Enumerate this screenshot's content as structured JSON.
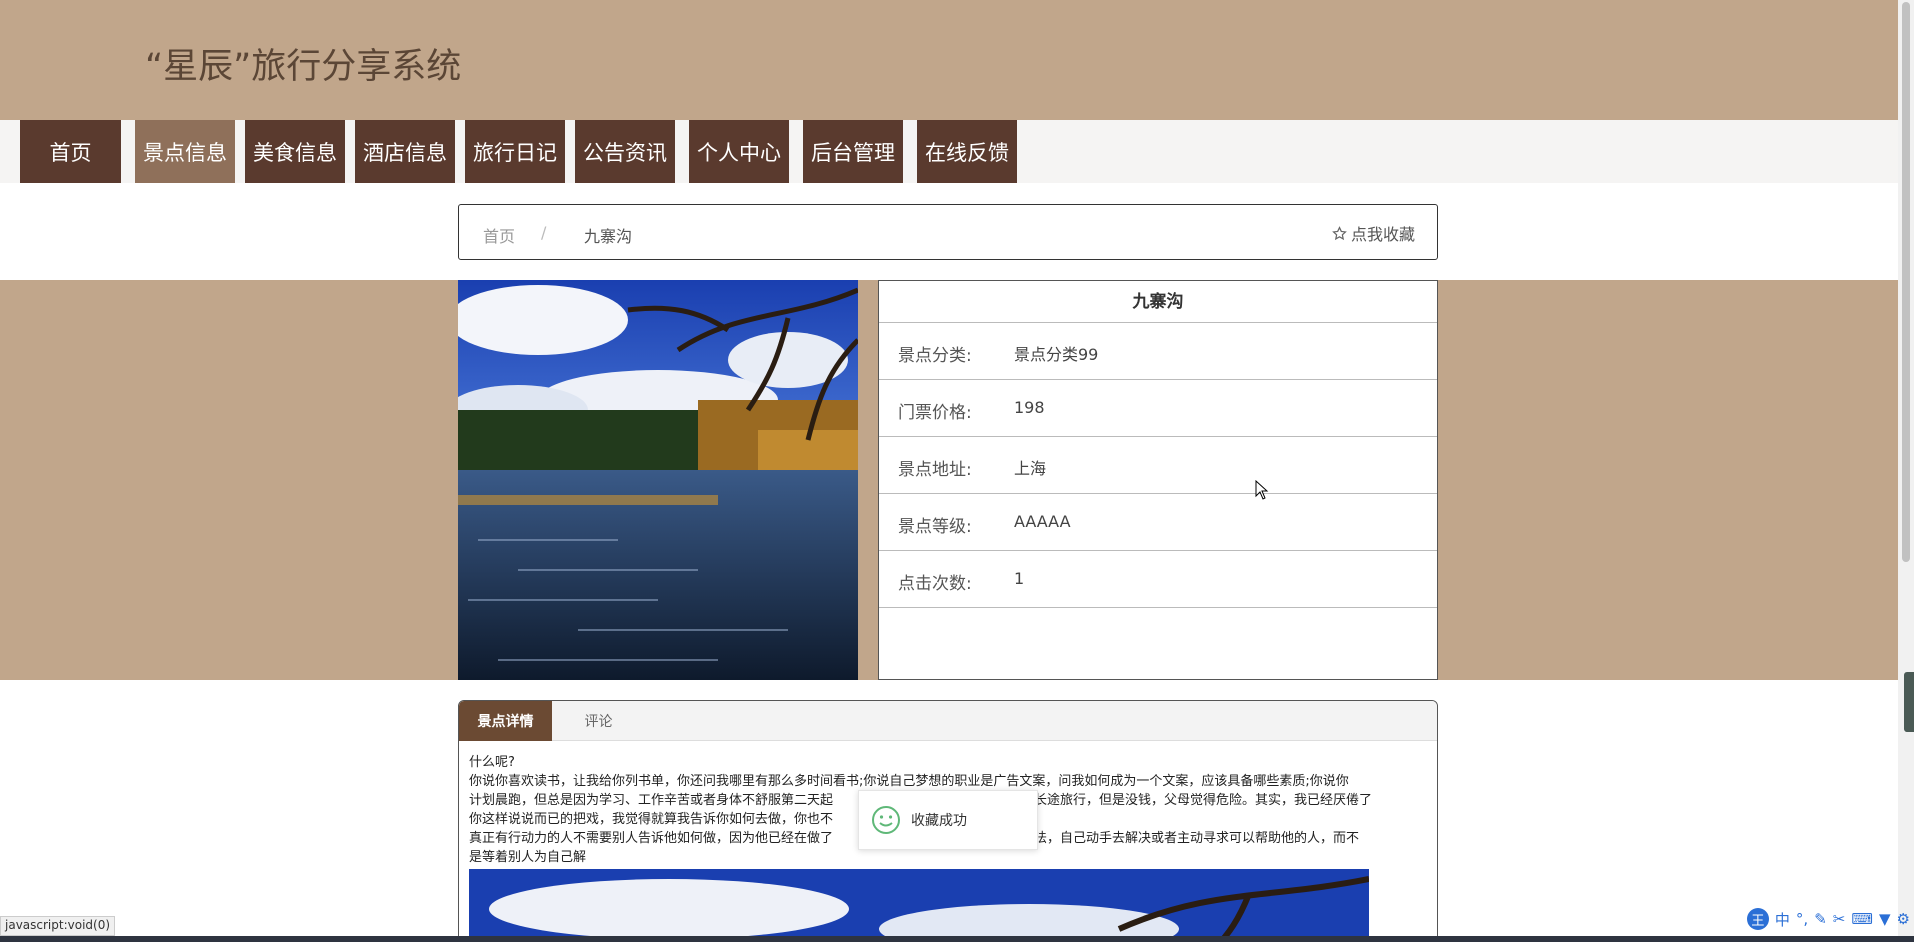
{
  "header": {
    "title": "“星辰”旅行分享系统"
  },
  "nav": {
    "items": [
      {
        "label": "首页"
      },
      {
        "label": "景点信息"
      },
      {
        "label": "美食信息"
      },
      {
        "label": "酒店信息"
      },
      {
        "label": "旅行日记"
      },
      {
        "label": "公告资讯"
      },
      {
        "label": "个人中心"
      },
      {
        "label": "后台管理"
      },
      {
        "label": "在线反馈"
      }
    ],
    "active_index": 1
  },
  "breadcrumb": {
    "home": "首页",
    "separator": "/",
    "current": "九寨沟",
    "favorite_label": "点我收藏"
  },
  "spot": {
    "title": "九寨沟",
    "rows": [
      {
        "label": "景点分类:",
        "value": "景点分类99"
      },
      {
        "label": "门票价格:",
        "value": "198"
      },
      {
        "label": "景点地址:",
        "value": "上海"
      },
      {
        "label": "景点等级:",
        "value": "AAAAA"
      },
      {
        "label": "点击次数:",
        "value": "1"
      }
    ]
  },
  "tabs": {
    "detail": "景点详情",
    "comments": "评论"
  },
  "content": {
    "line1": "什么呢?",
    "line2": "你说你喜欢读书，让我给你列书单，你还问我哪里有那么多时间看书;你说自己梦想的职业是广告文案，问我如何成为一个文案，应该具备哪些素质;你说你",
    "line3": "计划晨跑，但总是因为学习、工作辛苦或者身体不舒服第二天起",
    "line3b": "人去长途旅行，但是没钱，父母觉得危险。其实，我已经厌倦了",
    "line4": "你这样说说而已的把戏，我觉得就算我告诉你如何去做，你也不",
    "line4b": "做。",
    "line5": "真正有行动力的人不需要别人告诉他如何做，因为他已经在做了",
    "line5b": "想办法，自己动手去解决或者主动寻求可以帮助他的人，而不",
    "line6": "是等着别人为自己解"
  },
  "toast": {
    "message": "收藏成功"
  },
  "status_bar": {
    "text": "javascript:void(0)"
  },
  "ime": {
    "badge": "王",
    "mode": "中"
  },
  "colors": {
    "header_bg": "#c1a68b",
    "nav_bg": "#5a3a2e",
    "nav_active": "#8f705a",
    "tab_active": "#6b4a33"
  }
}
